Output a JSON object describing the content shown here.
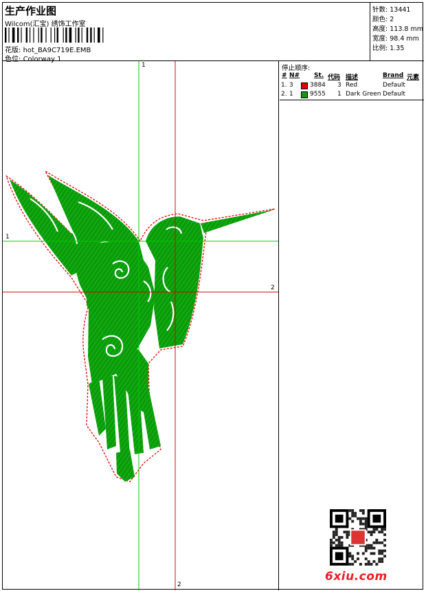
{
  "header": {
    "title": "生产作业图",
    "subtitle": "Wilcom(汇宝) 绣饰工作室",
    "file_label": "花版:",
    "file_name": "hot_BA9C719E.EMB",
    "colorway_label": "色位:",
    "colorway_name": "Colorway 1",
    "stats": [
      {
        "label": "针数:",
        "value": "13441"
      },
      {
        "label": "颜色:",
        "value": "2"
      },
      {
        "label": "高度:",
        "value": "113.8 mm"
      },
      {
        "label": "宽度:",
        "value": "98.4 mm"
      },
      {
        "label": "比例:",
        "value": "1.35"
      }
    ]
  },
  "design": {
    "axis_labels": {
      "green_top": "1",
      "green_left": "1",
      "red_right": "2",
      "red_bottom": "2"
    },
    "colors": {
      "fill": "#0a9a0a",
      "outline": "#ee1111",
      "axis_green": "#00cc00",
      "axis_red": "#dd0000"
    }
  },
  "sequence": {
    "title": "停止顺序:",
    "headers": {
      "num": "#",
      "n": "N#",
      "st": "St.",
      "code": "代码",
      "desc": "描述",
      "brand": "Brand",
      "element": "元素"
    },
    "rows": [
      {
        "num": "1.",
        "n": "3",
        "color": "#e00000",
        "st": "3884",
        "code": "3",
        "desc": "Red",
        "brand": "Default"
      },
      {
        "num": "2.",
        "n": "1",
        "color": "#109910",
        "st": "9555",
        "code": "1",
        "desc": "Dark Green",
        "brand": "Default"
      }
    ]
  },
  "footer": {
    "brand": "6xiu.com"
  }
}
